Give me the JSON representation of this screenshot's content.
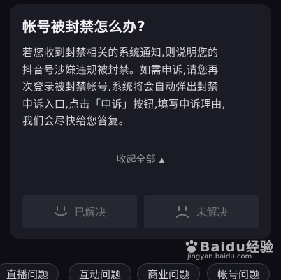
{
  "faq": {
    "title": "帐号被封禁怎么办?",
    "answer_lines": [
      "若您收到封禁相关的系统通知,则说明您的",
      "抖音号涉嫌违规被封禁。如需申诉,请您再",
      "次登录被封禁帐号,系统将会自动弹出封禁",
      "申诉入口,点击「申诉」按钮,填写申诉理由,",
      "我们会尽快给您答复。"
    ],
    "collapse_label": "收起全部",
    "collapse_icon": "triangle-up-icon"
  },
  "feedback": {
    "solved_label": "已解决",
    "solved_icon": "smile-face-icon",
    "unsolved_label": "未解决",
    "unsolved_icon": "frown-face-icon"
  },
  "category_tags": [
    "直播问题",
    "互动问题",
    "商业问题",
    "帐号问题"
  ],
  "watermark": {
    "brand": "Baidu经验",
    "url": "jingyan.baidu.com"
  },
  "colors": {
    "background": "#0d0d13",
    "card": "#1a1b25",
    "button": "#262731",
    "muted_text": "#77777f"
  }
}
